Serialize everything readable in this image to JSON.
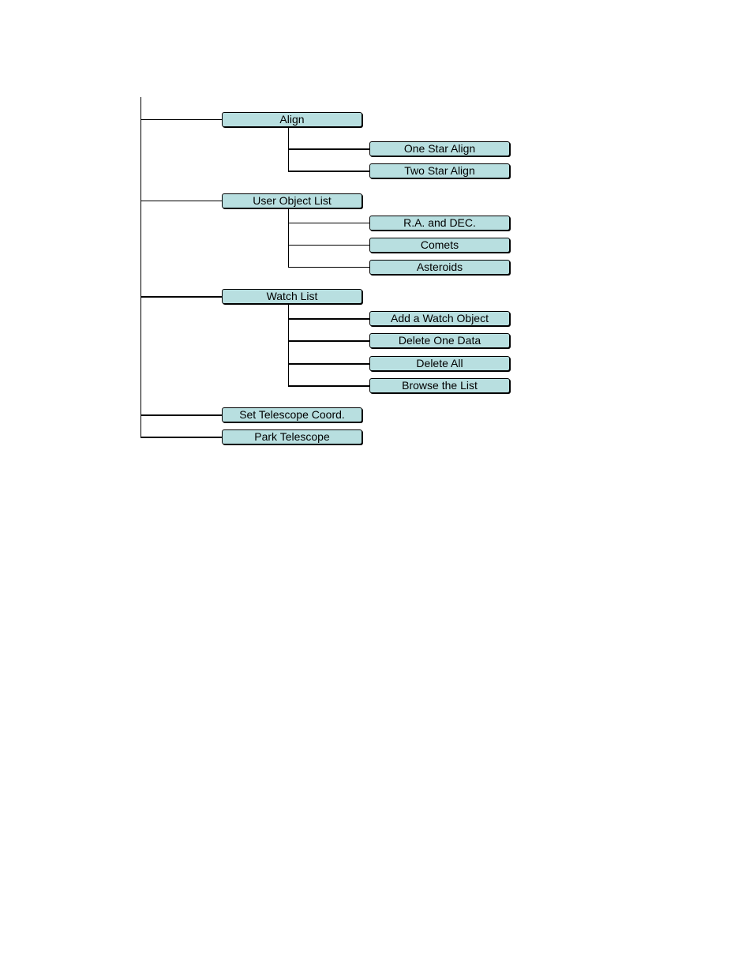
{
  "menu": [
    {
      "label": "Align",
      "children": [
        "One Star Align",
        "Two Star Align"
      ]
    },
    {
      "label": "User Object List",
      "children": [
        "R.A. and DEC.",
        "Comets",
        "Asteroids"
      ]
    },
    {
      "label": "Watch List",
      "children": [
        "Add a Watch Object",
        "Delete One Data",
        "Delete All",
        "Browse the List"
      ]
    },
    {
      "label": "Set Telescope Coord.",
      "children": []
    },
    {
      "label": "Park Telescope",
      "children": []
    }
  ],
  "colors": {
    "box_fill": "#b8dfe0",
    "line": "#000000"
  }
}
